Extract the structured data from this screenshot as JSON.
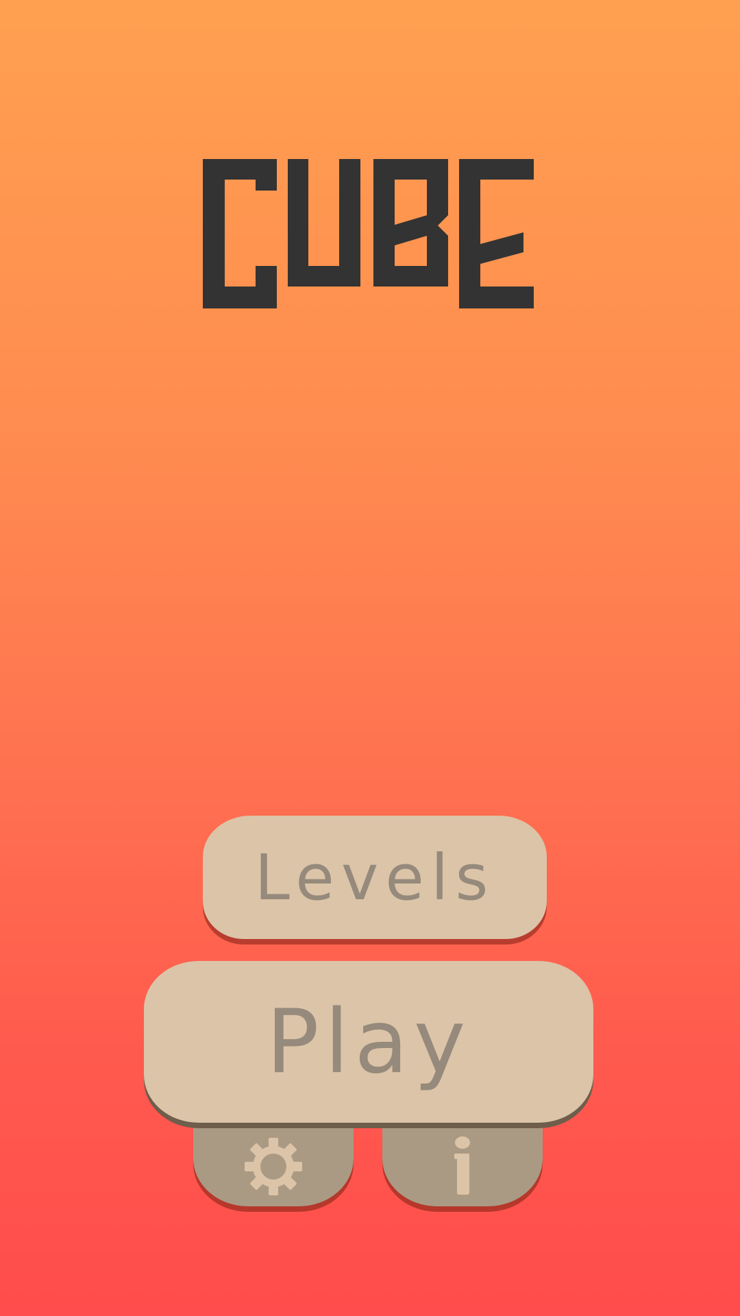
{
  "title": "CUBE",
  "menu": {
    "levels_label": "Levels",
    "play_label": "Play"
  },
  "icons": {
    "settings": "gear-icon",
    "info": "info-icon"
  },
  "colors": {
    "background_top": "#ffa050",
    "background_bottom": "#ff4c4c",
    "logo": "#333333",
    "button_face": "#dcc4a8",
    "button_text": "#958a7b",
    "small_button_face": "#aa9a84",
    "small_button_icon": "#dcc4a8"
  }
}
